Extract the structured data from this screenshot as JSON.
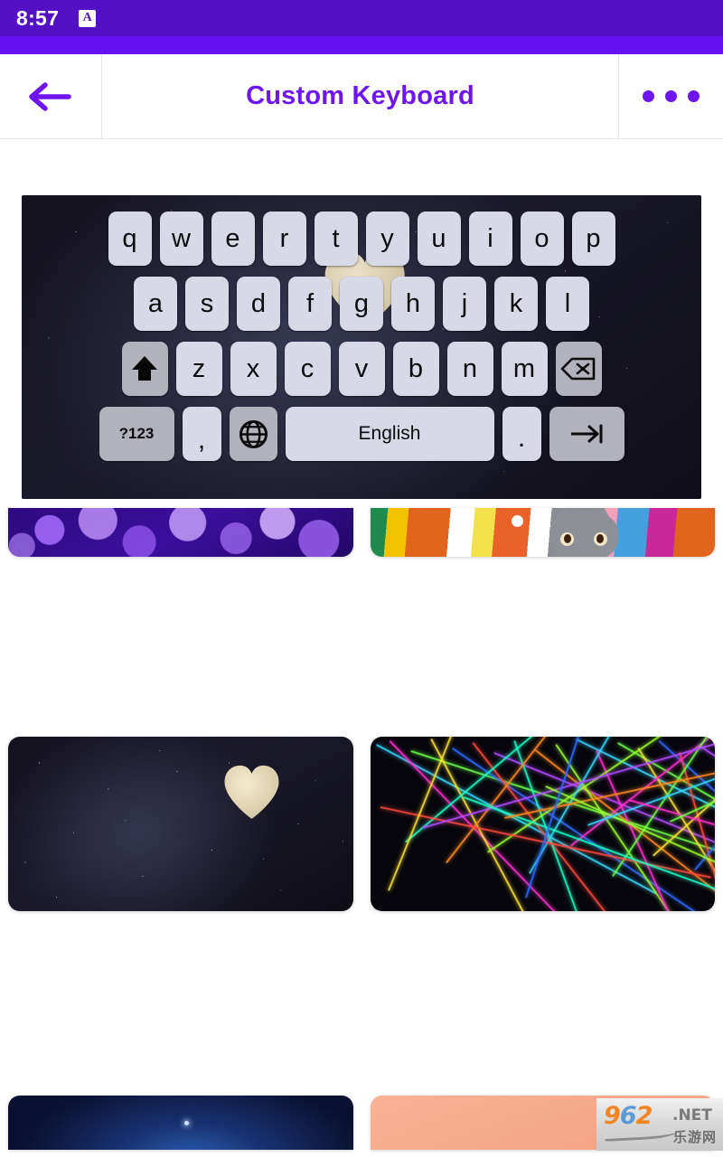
{
  "status_bar": {
    "time": "8:57",
    "badge_icon": "a-badge-icon",
    "badge_label": "A",
    "background": "#5410c4"
  },
  "accent_band": {
    "color": "#6610f2"
  },
  "header": {
    "back_icon": "back-arrow-icon",
    "title": "Custom Keyboard",
    "title_color": "#6f16f0",
    "overflow_icon": "more-options-icon"
  },
  "keyboard_preview": {
    "theme_name": "starry-night-heart",
    "key_color": "#d7d9e6",
    "special_key_color": "#b1b2bb",
    "rows": [
      {
        "name": "row-1",
        "keys": [
          "q",
          "w",
          "e",
          "r",
          "t",
          "y",
          "u",
          "i",
          "o",
          "p"
        ]
      },
      {
        "name": "row-2",
        "keys": [
          "a",
          "s",
          "d",
          "f",
          "g",
          "h",
          "j",
          "k",
          "l"
        ]
      },
      {
        "name": "row-3",
        "keys": [
          "z",
          "x",
          "c",
          "v",
          "b",
          "n",
          "m"
        ]
      }
    ],
    "shift_icon": "shift-icon",
    "backspace_icon": "backspace-icon",
    "symbols_label": "?123",
    "comma_label": ",",
    "globe_icon": "globe-language-icon",
    "space_label": "English",
    "period_label": ".",
    "enter_icon": "tab-enter-icon"
  },
  "gallery": {
    "rows": [
      {
        "name": "row-top-partial",
        "cards": [
          {
            "name": "theme-purple-bokeh",
            "art": "bokeh"
          },
          {
            "name": "theme-colorful-cats",
            "art": "cats"
          }
        ]
      },
      {
        "name": "row-middle",
        "cards": [
          {
            "name": "theme-starry-heart",
            "art": "stars"
          },
          {
            "name": "theme-laser-show",
            "art": "laser"
          }
        ]
      },
      {
        "name": "row-bottom-partial",
        "cards": [
          {
            "name": "theme-navy-night",
            "art": "navy"
          },
          {
            "name": "theme-peach-gradient",
            "art": "peach"
          }
        ]
      }
    ]
  },
  "watermark": {
    "digits_9": "9",
    "digits_6": "6",
    "digits_2": "2",
    "dot_net": ".NET",
    "chinese": "乐游网"
  }
}
